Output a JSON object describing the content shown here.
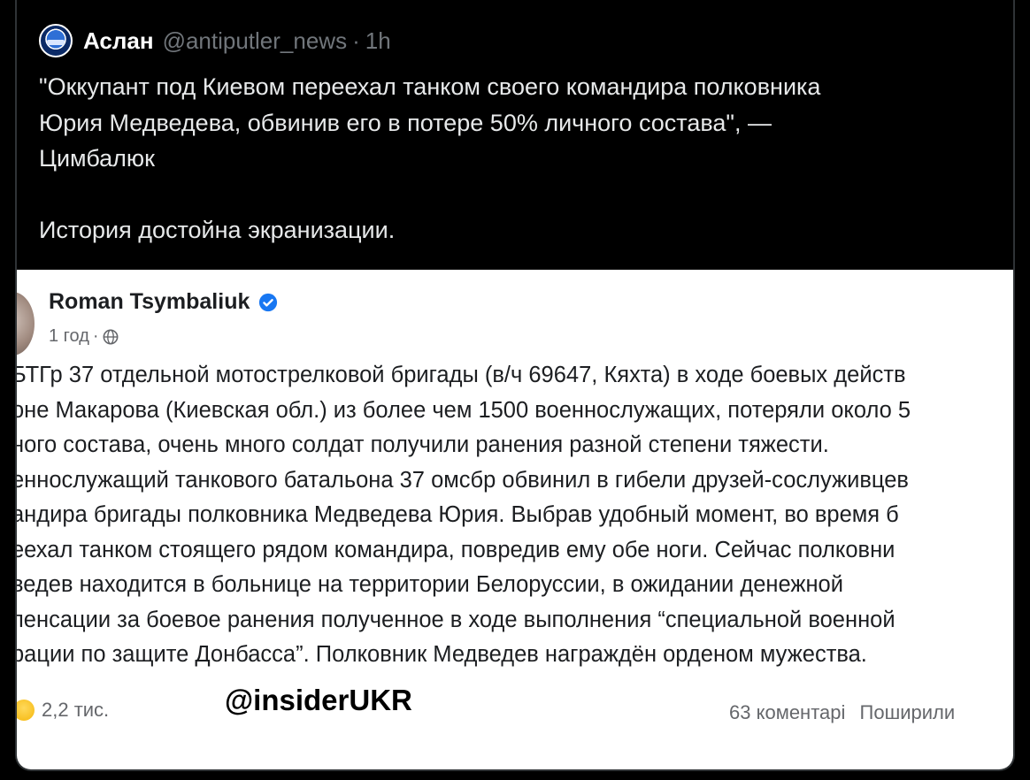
{
  "tweet": {
    "author_name": "Аслан",
    "handle": "@antiputler_news",
    "separator": "·",
    "time": "1h",
    "text": "\"Оккупант под Киевом переехал танком своего командира полковника\nЮрия Медведева, обвинив его в потере 50% личного состава\", —\nЦимбалюк\n\nИстория достойна экранизации."
  },
  "embedded_post": {
    "author_name": "Roman Tsymbaliuk",
    "time": "1 год",
    "dot": "·",
    "lines": [
      "БТГр 37 отдельной мотострелковой бригады (в/ч 69647, Кяхта) в ходе боевых действ",
      "оне Макарова (Киевская обл.) из более чем 1500 военнослужащих, потеряли около 5",
      "ного состава, очень много солдат получили ранения разной степени тяжести.",
      "еннослужащий танкового батальона 37 омсбр обвинил в гибели друзей-сослуживцев",
      "андира бригады полковника Медведева Юрия. Выбрав удобный момент, во время б",
      "еехал танком стоящего рядом командира, повредив ему обе ноги. Сейчас полковни",
      "ведев находится в больнице на территории Белоруссии, в ожидании денежной",
      "пенсации за боевое ранения полученное в ходе выполнения “специальной военной",
      "рации по защите Донбасса”. Полковник Медведев награждён орденом мужества."
    ],
    "reactions_count": "2,2 тис.",
    "watermark": "@insiderUKR",
    "comments": "63 коментарі",
    "shares": "Поширили"
  },
  "colors": {
    "background": "#000000",
    "tweet_text": "#e7e9ea",
    "muted": "#71767b",
    "verified": "#1877f2"
  },
  "icons": {
    "verified": "verified-check-icon",
    "audience": "globe-icon",
    "reaction": "emoji-reaction-icon"
  }
}
